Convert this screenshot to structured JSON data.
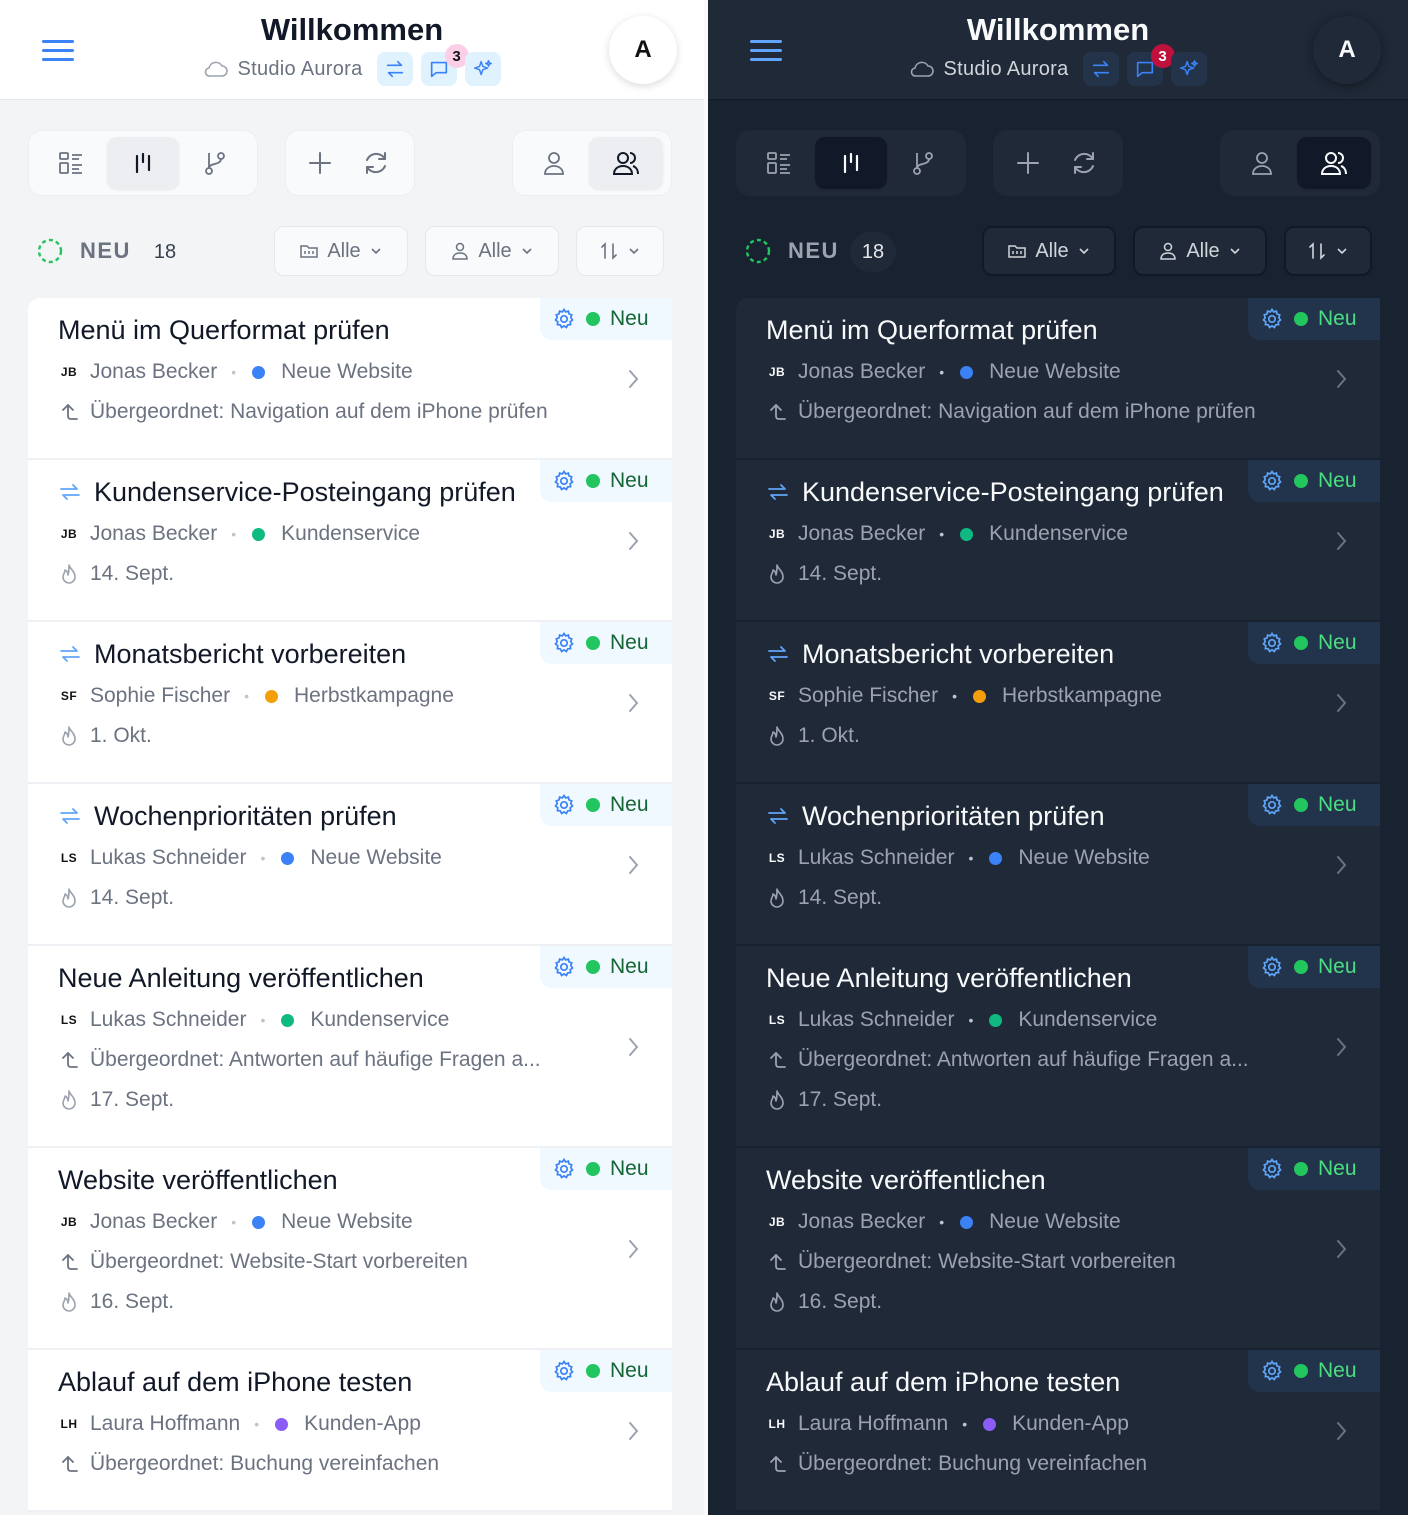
{
  "header": {
    "title": "Willkommen",
    "workspace": "Studio Aurora",
    "chat_badge_count": "3",
    "avatar_initial": "A"
  },
  "toolbar": {
    "view_modes": [
      "list-view",
      "board-view",
      "branch-view"
    ],
    "active_view": "board-view",
    "actions": [
      "add",
      "refresh"
    ],
    "scope": [
      "person",
      "team"
    ],
    "active_scope": "team"
  },
  "filters": {
    "status_label": "NEU",
    "status_count": "18",
    "project_filter": "Alle",
    "person_filter": "Alle"
  },
  "colors": {
    "accent": "#3b82f6",
    "status_green": "#22c55e",
    "project_blue": "#3b82f6",
    "project_green": "#10b981",
    "project_orange": "#f59e0b",
    "project_purple": "#8b5cf6"
  },
  "tasks": [
    {
      "title": "Menü im Querformat prüfen",
      "recurring": false,
      "initials": "JB",
      "assignee": "Jonas Becker",
      "project": "Neue Website",
      "project_color": "#3b82f6",
      "parent": "Übergeordnet: Navigation auf dem iPhone prüfen",
      "date": "",
      "status": "Neu"
    },
    {
      "title": "Kundenservice-Posteingang prüfen",
      "recurring": true,
      "initials": "JB",
      "assignee": "Jonas Becker",
      "project": "Kundenservice",
      "project_color": "#10b981",
      "parent": "",
      "date": "14. Sept.",
      "status": "Neu"
    },
    {
      "title": "Monatsbericht vorbereiten",
      "recurring": true,
      "initials": "SF",
      "assignee": "Sophie Fischer",
      "project": "Herbstkampagne",
      "project_color": "#f59e0b",
      "parent": "",
      "date": "1. Okt.",
      "status": "Neu"
    },
    {
      "title": "Wochenprioritäten prüfen",
      "recurring": true,
      "initials": "LS",
      "assignee": "Lukas Schneider",
      "project": "Neue Website",
      "project_color": "#3b82f6",
      "parent": "",
      "date": "14. Sept.",
      "status": "Neu"
    },
    {
      "title": "Neue Anleitung veröffentlichen",
      "recurring": false,
      "initials": "LS",
      "assignee": "Lukas Schneider",
      "project": "Kundenservice",
      "project_color": "#10b981",
      "parent": "Übergeordnet: Antworten auf häufige Fragen a...",
      "date": "17. Sept.",
      "status": "Neu"
    },
    {
      "title": "Website veröffentlichen",
      "recurring": false,
      "initials": "JB",
      "assignee": "Jonas Becker",
      "project": "Neue Website",
      "project_color": "#3b82f6",
      "parent": "Übergeordnet: Website-Start vorbereiten",
      "date": "16. Sept.",
      "status": "Neu"
    },
    {
      "title": "Ablauf auf dem iPhone testen",
      "recurring": false,
      "initials": "LH",
      "assignee": "Laura Hoffmann",
      "project": "Kunden-App",
      "project_color": "#8b5cf6",
      "parent": "Übergeordnet: Buchung vereinfachen",
      "date": "",
      "status": "Neu"
    }
  ]
}
